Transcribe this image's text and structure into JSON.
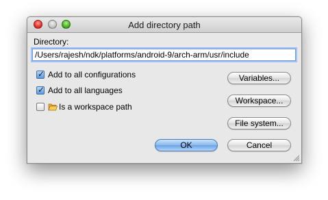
{
  "window": {
    "title": "Add directory path"
  },
  "directory": {
    "label": "Directory:",
    "value": "/Users/rajesh/ndk/platforms/android-9/arch-arm/usr/include"
  },
  "options": [
    {
      "label": "Add to all configurations",
      "checked": true
    },
    {
      "label": "Add to all languages",
      "checked": true
    },
    {
      "label": "Is a workspace path",
      "checked": false,
      "icon": "folder-icon"
    }
  ],
  "buttons": {
    "variables": "Variables...",
    "workspace": "Workspace...",
    "file_system": "File system...",
    "ok": "OK",
    "cancel": "Cancel"
  },
  "colors": {
    "focus_ring": "#9fc2ee",
    "default_button": "#6aa2e6",
    "window_bg": "#e8e8e8"
  }
}
